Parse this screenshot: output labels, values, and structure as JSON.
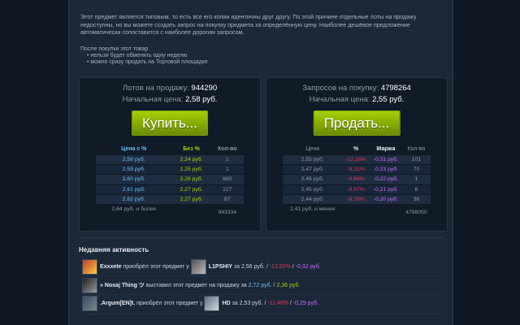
{
  "description": "Этот предмет является типовым, то есть все его копии идентичны друг другу. По этой причине отдельные лоты на продажу недоступны, но вы можете создать запрос на покупку предмета за определённую цену. Наиболее дешёвое предложение автоматически сопоставится с наиболее дорогим запросом.",
  "after_purchase": {
    "title": "После покупки этот товар",
    "items": [
      "нельзя будет обменять одну неделю",
      "можно сразу продать на Торговой площадке"
    ]
  },
  "buy_panel": {
    "lots_label": "Лотов на продажу:",
    "lots_value": "944290",
    "price_label": "Начальная цена:",
    "price_value": "2,58 руб.",
    "button": "Купить...",
    "headers": [
      "Цена с %",
      "Без %",
      "Кол-во"
    ],
    "rows": [
      [
        "2,58 руб.",
        "2,24 руб.",
        "1"
      ],
      [
        "2,59 руб.",
        "2,25 руб.",
        "1"
      ],
      [
        "2,60 руб.",
        "2,26 руб.",
        "660"
      ],
      [
        "2,61 руб.",
        "2,27 руб.",
        "227"
      ],
      [
        "2,62 руб.",
        "2,27 руб.",
        "67"
      ]
    ],
    "footer": [
      "2,64 руб. и более",
      "",
      "943334"
    ]
  },
  "sell_panel": {
    "requests_label": "Запросов на покупку:",
    "requests_value": "4798264",
    "price_label": "Начальная цена:",
    "price_value": "2,55 руб.",
    "button": "Продать...",
    "headers": [
      "Цена",
      "%",
      "Маржа",
      "Кол-во"
    ],
    "rows": [
      [
        "2,55 руб.",
        "-12,16%",
        "-0,31 руб.",
        "101"
      ],
      [
        "2,47 руб.",
        "-9,31%",
        "-0,23 руб.",
        "70"
      ],
      [
        "2,46 руб.",
        "-8,94%",
        "-0,22 руб.",
        "1"
      ],
      [
        "2,45 руб.",
        "-8,57%",
        "-0,21 руб.",
        "6"
      ],
      [
        "2,44 руб.",
        "-8,20%",
        "-0,20 руб.",
        "36"
      ]
    ],
    "footer": [
      "2,41 руб. и менее",
      "",
      "",
      "4798050"
    ]
  },
  "recent": {
    "title": "Недавняя активность",
    "items": [
      {
        "user": "Exxxete",
        "action": "приобрёл этот предмет у",
        "other": "L1PSHIY",
        "price": "за 2,56 руб.",
        "sep": " / ",
        "pct": "-12,50%",
        "sep2": " / ",
        "margin": "-0,32 руб."
      },
      {
        "user": "» Nosaj Thing ツ",
        "action": "выставил этот предмет на продажу за",
        "price": "2,72 руб.",
        "sep": " / ",
        "net": "2,36 руб."
      },
      {
        "user": ".Argum[EN]t.",
        "action": "приобрёл этот предмет у",
        "other": "HD",
        "price": "за 2,53 руб.",
        "sep": " / ",
        "pct": "-11,46%",
        "sep2": " / ",
        "margin": "-0,29 руб."
      }
    ]
  },
  "colors": {
    "accent_green": "#a4d007",
    "accent_blue": "#66c0f4",
    "negative": "#e13b54",
    "margin": "#c86bfa"
  }
}
